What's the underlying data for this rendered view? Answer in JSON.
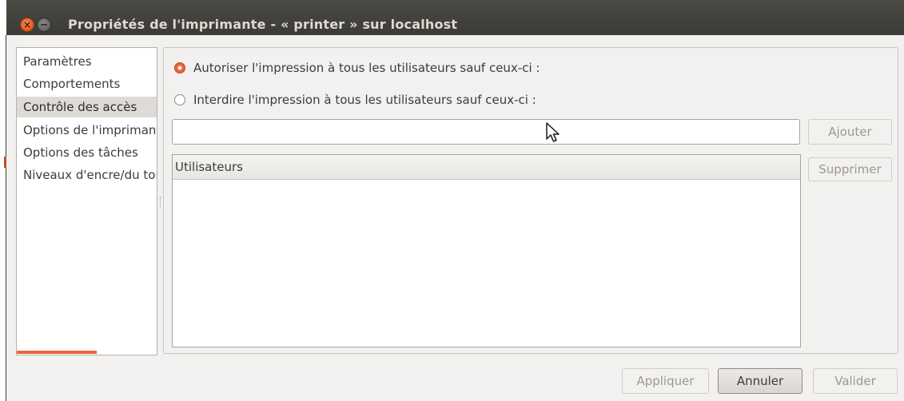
{
  "window": {
    "title": "Propriétés de l'imprimante - « printer » sur localhost",
    "close_glyph": "×"
  },
  "sidebar": {
    "items": [
      {
        "label": "Paramètres",
        "selected": false
      },
      {
        "label": "Comportements",
        "selected": false
      },
      {
        "label": "Contrôle des accès",
        "selected": true
      },
      {
        "label": "Options de l'imprimante",
        "selected": false
      },
      {
        "label": "Options des tâches",
        "selected": false
      },
      {
        "label": "Niveaux d'encre/du toner",
        "selected": false
      }
    ]
  },
  "access": {
    "allow_label": "Autoriser l'impression à tous les utilisateurs sauf ceux-ci :",
    "allow_checked": true,
    "deny_label": "Interdire l'impression à tous les utilisateurs sauf ceux-ci :",
    "deny_checked": false,
    "user_input_value": "",
    "add_button": "Ajouter",
    "remove_button": "Supprimer",
    "users_column_header": "Utilisateurs",
    "users": []
  },
  "footer": {
    "apply_button": "Appliquer",
    "cancel_button": "Annuler",
    "ok_button": "Valider"
  },
  "colors": {
    "accent": "#e8643c",
    "titlebar": "#3c3b37",
    "window_bg": "#f2f1f0"
  }
}
